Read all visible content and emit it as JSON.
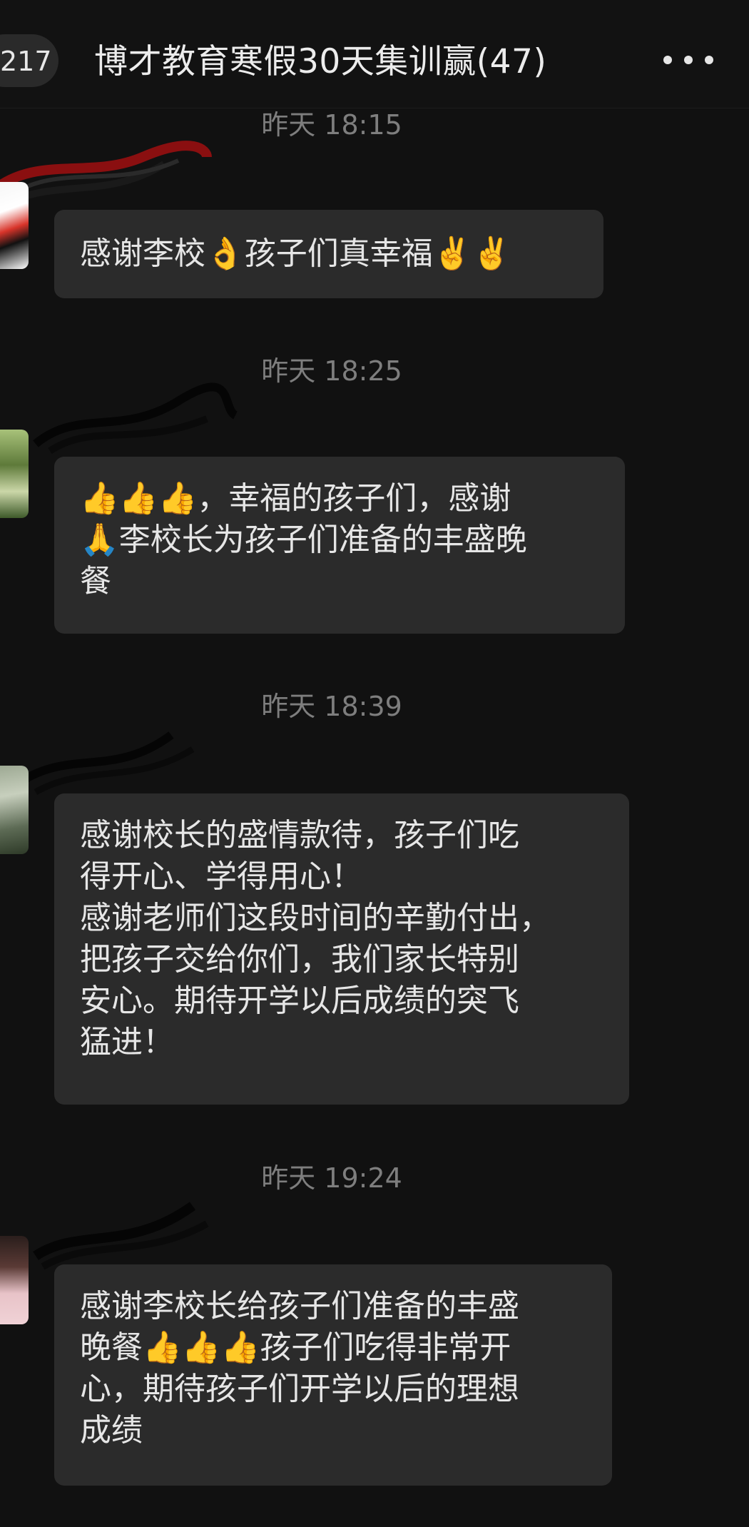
{
  "header": {
    "back_count": "217",
    "title": "博才教育寒假30天集训赢(47)"
  },
  "messages": [
    {
      "time": "昨天 18:15",
      "lines": [
        "感谢李校👌孩子们真幸福✌️✌️"
      ]
    },
    {
      "time": "昨天 18:25",
      "lines": [
        "👍👍👍，幸福的孩子们，感谢",
        "🙏李校长为孩子们准备的丰盛晚",
        "餐"
      ]
    },
    {
      "time": "昨天 18:39",
      "lines": [
        "感谢校长的盛情款待，孩子们吃",
        "得开心、学得用心！",
        "感谢老师们这段时间的辛勤付出，",
        "把孩子交给你们，我们家长特别",
        "安心。期待开学以后成绩的突飞",
        "猛进！"
      ]
    },
    {
      "time": "昨天 19:24",
      "lines": [
        "感谢李校长给孩子们准备的丰盛",
        "晚餐👍👍👍孩子们吃得非常开",
        "心，期待孩子们开学以后的理想",
        "成绩"
      ]
    }
  ]
}
